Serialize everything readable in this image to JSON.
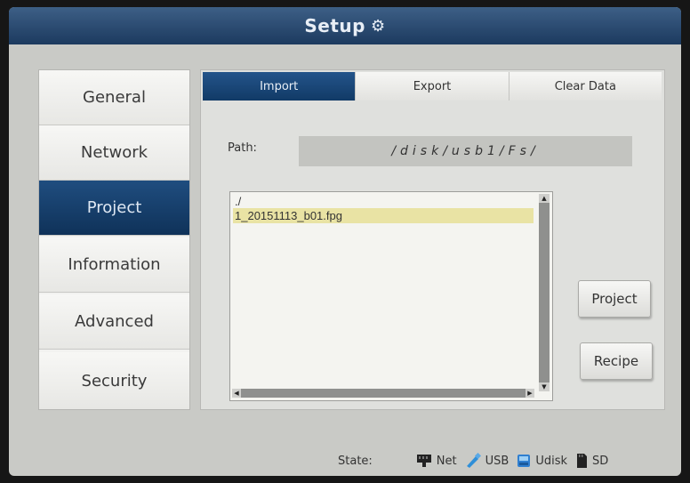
{
  "window": {
    "title": "Setup"
  },
  "sidebar": {
    "items": [
      {
        "label": "General",
        "active": false
      },
      {
        "label": "Network",
        "active": false
      },
      {
        "label": "Project",
        "active": true
      },
      {
        "label": "Information",
        "active": false
      },
      {
        "label": "Advanced",
        "active": false
      },
      {
        "label": "Security",
        "active": false
      }
    ]
  },
  "tabs": [
    {
      "label": "Import",
      "active": true
    },
    {
      "label": "Export",
      "active": false
    },
    {
      "label": "Clear Data",
      "active": false
    }
  ],
  "path": {
    "label": "Path:",
    "value": "/disk/usb1/Fs/"
  },
  "files": [
    {
      "name": "./",
      "selected": false
    },
    {
      "name": "1_20151113_b01.fpg",
      "selected": true
    }
  ],
  "buttons": {
    "project": "Project",
    "recipe": "Recipe"
  },
  "status": {
    "label": "State:",
    "items": [
      {
        "label": "Net",
        "icon": "network-icon"
      },
      {
        "label": "USB",
        "icon": "usb-icon"
      },
      {
        "label": "Udisk",
        "icon": "udisk-icon"
      },
      {
        "label": "SD",
        "icon": "sd-card-icon"
      }
    ]
  },
  "colors": {
    "accent": "#1f4d7f",
    "selection": "#e9e3a4",
    "usb_icon": "#2f8fd8",
    "udisk_icon": "#2f7fd0"
  }
}
